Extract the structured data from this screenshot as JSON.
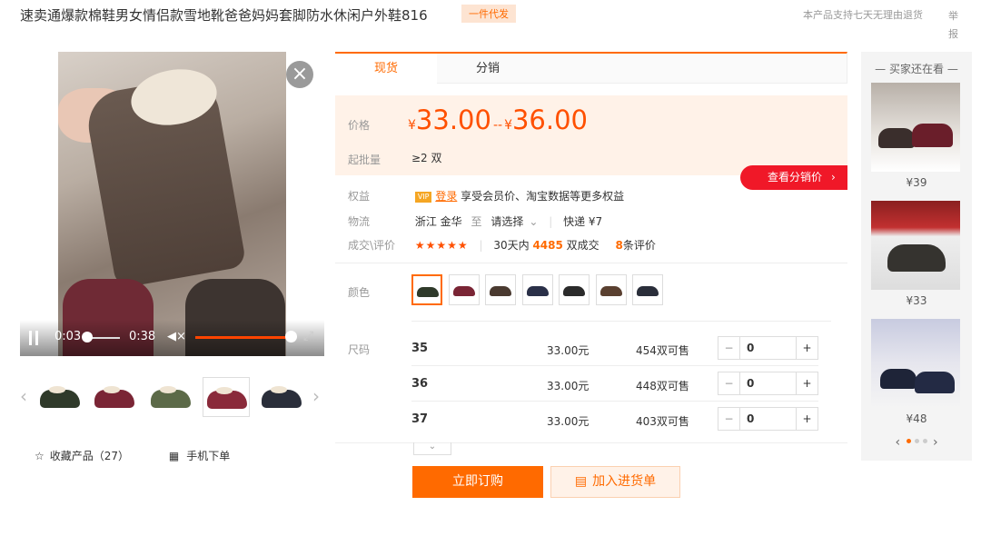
{
  "header": {
    "title": "速卖通爆款棉鞋男女情侣款雪地靴爸爸妈妈套脚防水休闲户外鞋816",
    "badge": "一件代发",
    "note": "本产品支持七天无理由退货",
    "report": "举报"
  },
  "video": {
    "time_current": "0:03",
    "time_total": "0:38",
    "progress_fraction": 0.08,
    "volume_fraction": 0.95,
    "close_icon": "close-icon",
    "pause_icon": "pause-icon",
    "volume_icon": "volume-icon",
    "fullscreen_icon": "fullscreen-icon"
  },
  "thumbnails": [
    {
      "color": "#2f3a2a"
    },
    {
      "color": "#7a2535"
    },
    {
      "color": "#5c6a48"
    },
    {
      "color": "#8a2a3a"
    },
    {
      "color": "#2a2e3a"
    }
  ],
  "actions": {
    "favorite_label": "收藏产品（27）",
    "mobile_label": "手机下单"
  },
  "tabs": [
    "现货",
    "分销"
  ],
  "price": {
    "label": "价格",
    "currency": "¥",
    "low": "33.00",
    "sep": "--",
    "high": "36.00",
    "min_label": "起批量",
    "min_value": "≥2 双",
    "dist_button": "查看分销价"
  },
  "info": {
    "rights_label": "权益",
    "vip": "VIP",
    "login": "登录",
    "rights_text": "享受会员价、淘宝数据等更多权益",
    "logistics_label": "物流",
    "origin": "浙江 金华",
    "to": "至",
    "select": "请选择",
    "express": "快递 ¥7",
    "deal_label": "成交\\评价",
    "stars": "★★★★★",
    "deal_prefix": "30天内",
    "deal_count": "4485",
    "deal_suffix": "双成交",
    "review_count": "8",
    "review_suffix": "条评价"
  },
  "color_label": "颜色",
  "colors": [
    "#2f3a2a",
    "#7a2535",
    "#4a3a30",
    "#2a3048",
    "#2b2b2b",
    "#5a4030",
    "#2a2e3a"
  ],
  "size_label": "尺码",
  "sizes": [
    {
      "size": "35",
      "price": "33.00元",
      "stock": "454双可售",
      "qty": "0"
    },
    {
      "size": "36",
      "price": "33.00元",
      "stock": "448双可售",
      "qty": "0"
    },
    {
      "size": "37",
      "price": "33.00元",
      "stock": "403双可售",
      "qty": "0"
    }
  ],
  "buttons": {
    "buy": "立即订购",
    "cart": "加入进货单"
  },
  "sidebar": {
    "title": "买家还在看",
    "items": [
      {
        "price": "¥39"
      },
      {
        "price": "¥33"
      },
      {
        "price": "¥48"
      }
    ]
  }
}
